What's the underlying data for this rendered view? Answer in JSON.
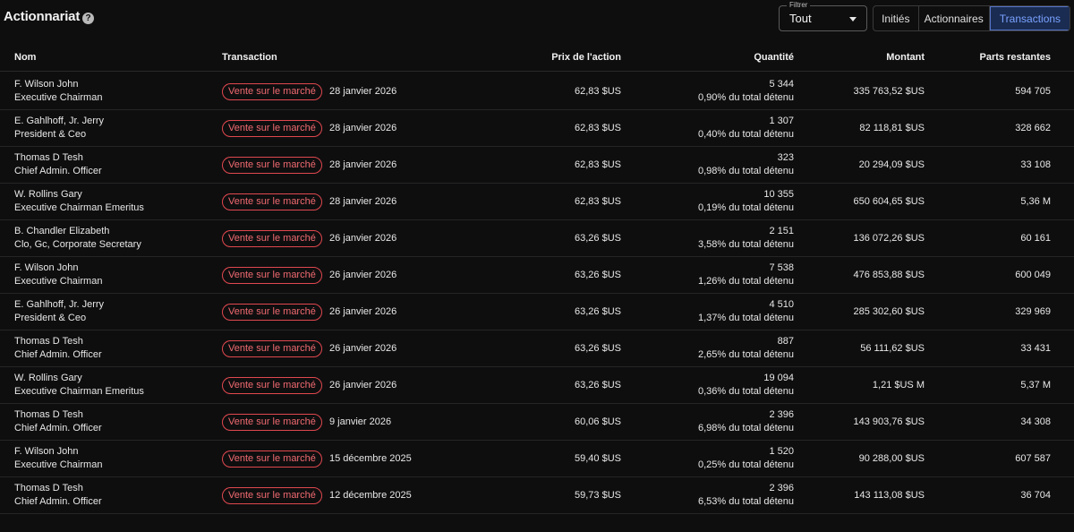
{
  "header": {
    "title": "Actionnariat",
    "help_icon": "question-circle-icon",
    "filter": {
      "legend": "Filtrer",
      "value": "Tout"
    },
    "tabs": [
      {
        "label": "Initiés",
        "active": false
      },
      {
        "label": "Actionnaires",
        "active": false
      },
      {
        "label": "Transactions",
        "active": true
      }
    ]
  },
  "colors": {
    "background": "#0e0e0f",
    "accent": "#7aa2ff",
    "badge": "#e0484e"
  },
  "table": {
    "columns": [
      "Nom",
      "Transaction",
      "Prix de l'action",
      "Quantité",
      "Montant",
      "Parts restantes"
    ],
    "rows": [
      {
        "name": "F. Wilson John",
        "role": "Executive Chairman",
        "type": "Vente sur le marché",
        "date": "28 janvier 2026",
        "price": "62,83 $US",
        "qty": "5 344",
        "pct": "0,90% du total détenu",
        "amount": "335 763,52 $US",
        "remaining": "594 705"
      },
      {
        "name": "E. Gahlhoff, Jr. Jerry",
        "role": "President & Ceo",
        "type": "Vente sur le marché",
        "date": "28 janvier 2026",
        "price": "62,83 $US",
        "qty": "1 307",
        "pct": "0,40% du total détenu",
        "amount": "82 118,81 $US",
        "remaining": "328 662"
      },
      {
        "name": "Thomas D Tesh",
        "role": "Chief Admin. Officer",
        "type": "Vente sur le marché",
        "date": "28 janvier 2026",
        "price": "62,83 $US",
        "qty": "323",
        "pct": "0,98% du total détenu",
        "amount": "20 294,09 $US",
        "remaining": "33 108"
      },
      {
        "name": "W. Rollins Gary",
        "role": "Executive Chairman Emeritus",
        "type": "Vente sur le marché",
        "date": "28 janvier 2026",
        "price": "62,83 $US",
        "qty": "10 355",
        "pct": "0,19% du total détenu",
        "amount": "650 604,65 $US",
        "remaining": "5,36 M"
      },
      {
        "name": "B. Chandler Elizabeth",
        "role": "Clo, Gc, Corporate Secretary",
        "type": "Vente sur le marché",
        "date": "26 janvier 2026",
        "price": "63,26 $US",
        "qty": "2 151",
        "pct": "3,58% du total détenu",
        "amount": "136 072,26 $US",
        "remaining": "60 161"
      },
      {
        "name": "F. Wilson John",
        "role": "Executive Chairman",
        "type": "Vente sur le marché",
        "date": "26 janvier 2026",
        "price": "63,26 $US",
        "qty": "7 538",
        "pct": "1,26% du total détenu",
        "amount": "476 853,88 $US",
        "remaining": "600 049"
      },
      {
        "name": "E. Gahlhoff, Jr. Jerry",
        "role": "President & Ceo",
        "type": "Vente sur le marché",
        "date": "26 janvier 2026",
        "price": "63,26 $US",
        "qty": "4 510",
        "pct": "1,37% du total détenu",
        "amount": "285 302,60 $US",
        "remaining": "329 969"
      },
      {
        "name": "Thomas D Tesh",
        "role": "Chief Admin. Officer",
        "type": "Vente sur le marché",
        "date": "26 janvier 2026",
        "price": "63,26 $US",
        "qty": "887",
        "pct": "2,65% du total détenu",
        "amount": "56 111,62 $US",
        "remaining": "33 431"
      },
      {
        "name": "W. Rollins Gary",
        "role": "Executive Chairman Emeritus",
        "type": "Vente sur le marché",
        "date": "26 janvier 2026",
        "price": "63,26 $US",
        "qty": "19 094",
        "pct": "0,36% du total détenu",
        "amount": "1,21 $US M",
        "remaining": "5,37 M"
      },
      {
        "name": "Thomas D Tesh",
        "role": "Chief Admin. Officer",
        "type": "Vente sur le marché",
        "date": "9 janvier 2026",
        "price": "60,06 $US",
        "qty": "2 396",
        "pct": "6,98% du total détenu",
        "amount": "143 903,76 $US",
        "remaining": "34 308"
      },
      {
        "name": "F. Wilson John",
        "role": "Executive Chairman",
        "type": "Vente sur le marché",
        "date": "15 décembre 2025",
        "price": "59,40 $US",
        "qty": "1 520",
        "pct": "0,25% du total détenu",
        "amount": "90 288,00 $US",
        "remaining": "607 587"
      },
      {
        "name": "Thomas D Tesh",
        "role": "Chief Admin. Officer",
        "type": "Vente sur le marché",
        "date": "12 décembre 2025",
        "price": "59,73 $US",
        "qty": "2 396",
        "pct": "6,53% du total détenu",
        "amount": "143 113,08 $US",
        "remaining": "36 704"
      }
    ]
  }
}
